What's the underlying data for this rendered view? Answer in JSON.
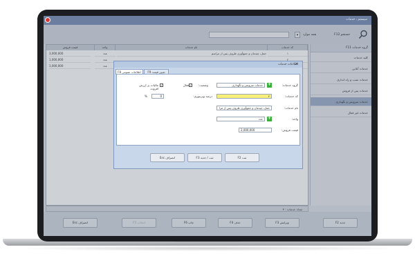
{
  "app": {
    "title": "سیستم ـ خدمات"
  },
  "search": {
    "filter_value": "همه موارد",
    "label": "جستجو F12",
    "placeholder": ""
  },
  "sidebar": {
    "header": "گروه خدمات F11",
    "items": [
      {
        "label": "کلیه خدمات"
      },
      {
        "label": "خدمات آنلاین"
      },
      {
        "label": "خدمات نصب و راه اندازی"
      },
      {
        "label": "خدمات پس از فروش"
      },
      {
        "label": "خدمات سرویس و نگهداری"
      },
      {
        "label": "خدمات غیر فعال"
      }
    ]
  },
  "table": {
    "columns": [
      "کد خدمات",
      "نام خدمات",
      "واحد",
      "قیمت فروش"
    ],
    "rows": [
      {
        "code": "۱",
        "name": "حمل، چیدمان و جمع‌آوری ظروف پس از مراسم",
        "unit": "عدد",
        "price": "3,000,000"
      },
      {
        "code": "۲",
        "name": "",
        "unit": "عدد",
        "price": "1,000,000"
      },
      {
        "code": "۳",
        "name": "",
        "unit": "عدد",
        "price": "1,000,000"
      }
    ],
    "count_label": "تعداد خدمات : ۳"
  },
  "toolbar": {
    "new": "جدید F2",
    "edit": "ویرایش F3",
    "delete": "حذف F4",
    "print": "چاپ F6",
    "select": "انتخاب F5",
    "cancel": "انصراف Esc"
  },
  "dialog": {
    "title": "اطلاعات خدمات",
    "tabs": {
      "general": "اطلاعات عمومی F8",
      "pricing": "تعیین قیمت F9"
    },
    "fields": {
      "group_label": "گروه خدمات:",
      "group_value": "خدمات سرویس و نگهداری",
      "code_label": "کد خدمات:",
      "code_value": "۴",
      "name_label": "نام خدمات:",
      "name_value": "حمل، چیدمان و جمع‌آوری ظروف پس از مرا",
      "unit_label": "واحد:",
      "unit_value": "عدد",
      "price_label": "قیمت فروش:",
      "price_value": "2,000,000",
      "status_label": "وضعیت:",
      "status_value": "فعال",
      "discount_label": "درصد ویزیتوری:",
      "discount_value": "0",
      "percent_symbol": "%",
      "tax_label": "مالیات بر ارزش افزوده"
    },
    "buttons": {
      "save": "ثبت F2",
      "save_new": "ثبت / جدید F3",
      "cancel": "انصراف Esc"
    }
  },
  "colors": {
    "selected_sidebar": "#9fb1ca",
    "highlight_field": "#f7ef7a",
    "close_button": "#d63636",
    "plus_button": "#3cae3c"
  }
}
